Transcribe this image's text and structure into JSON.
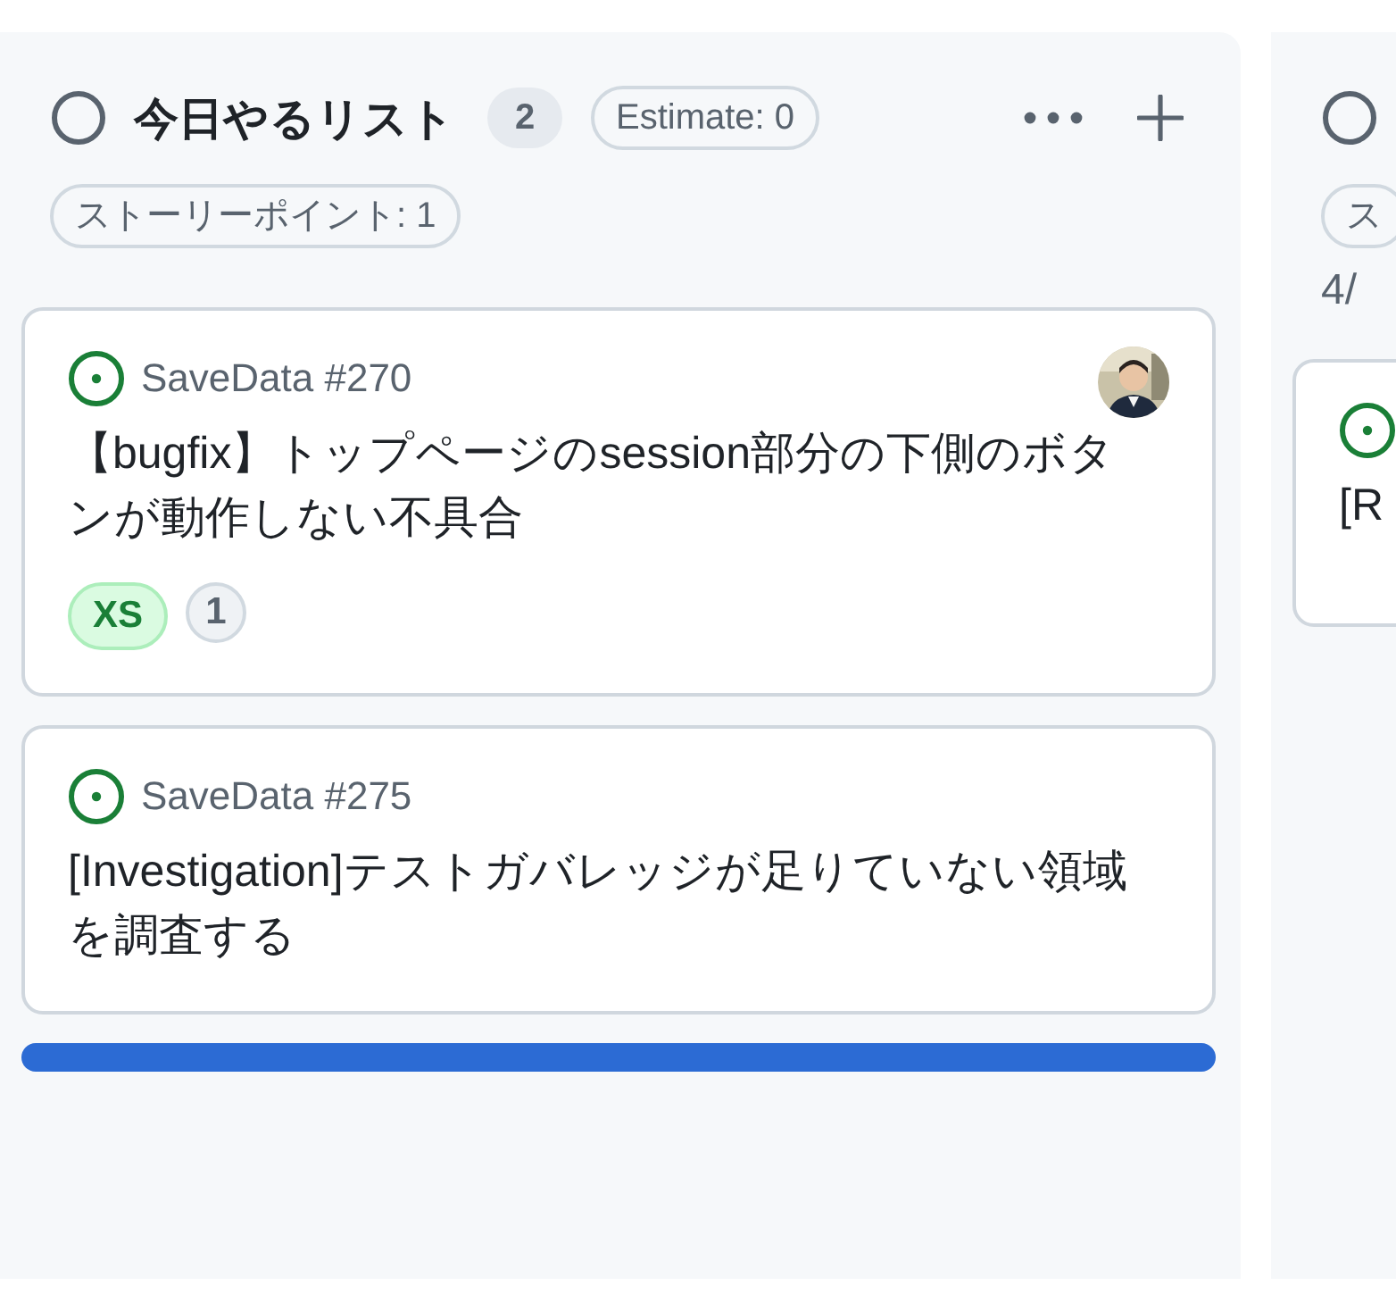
{
  "columns": [
    {
      "title": "今日やるリスト",
      "count": "2",
      "estimate": "Estimate: 0",
      "story_points": "ストーリーポイント: 1",
      "drop_indicator": true,
      "cards": [
        {
          "repo": "SaveData #270",
          "title": "【bugfix】トップページのsession部分の下側のボタンが動作しない不具合",
          "labels": [
            {
              "text": "XS",
              "kind": "size"
            },
            {
              "text": "1",
              "kind": "count"
            }
          ]
        },
        {
          "repo": "SaveData #275",
          "title": "[Investigation]テストガバレッジが足りていない領域を調査する"
        }
      ]
    },
    {
      "story_points": "ス",
      "date": "4/",
      "cards": [
        {
          "title": "[R"
        }
      ]
    }
  ]
}
